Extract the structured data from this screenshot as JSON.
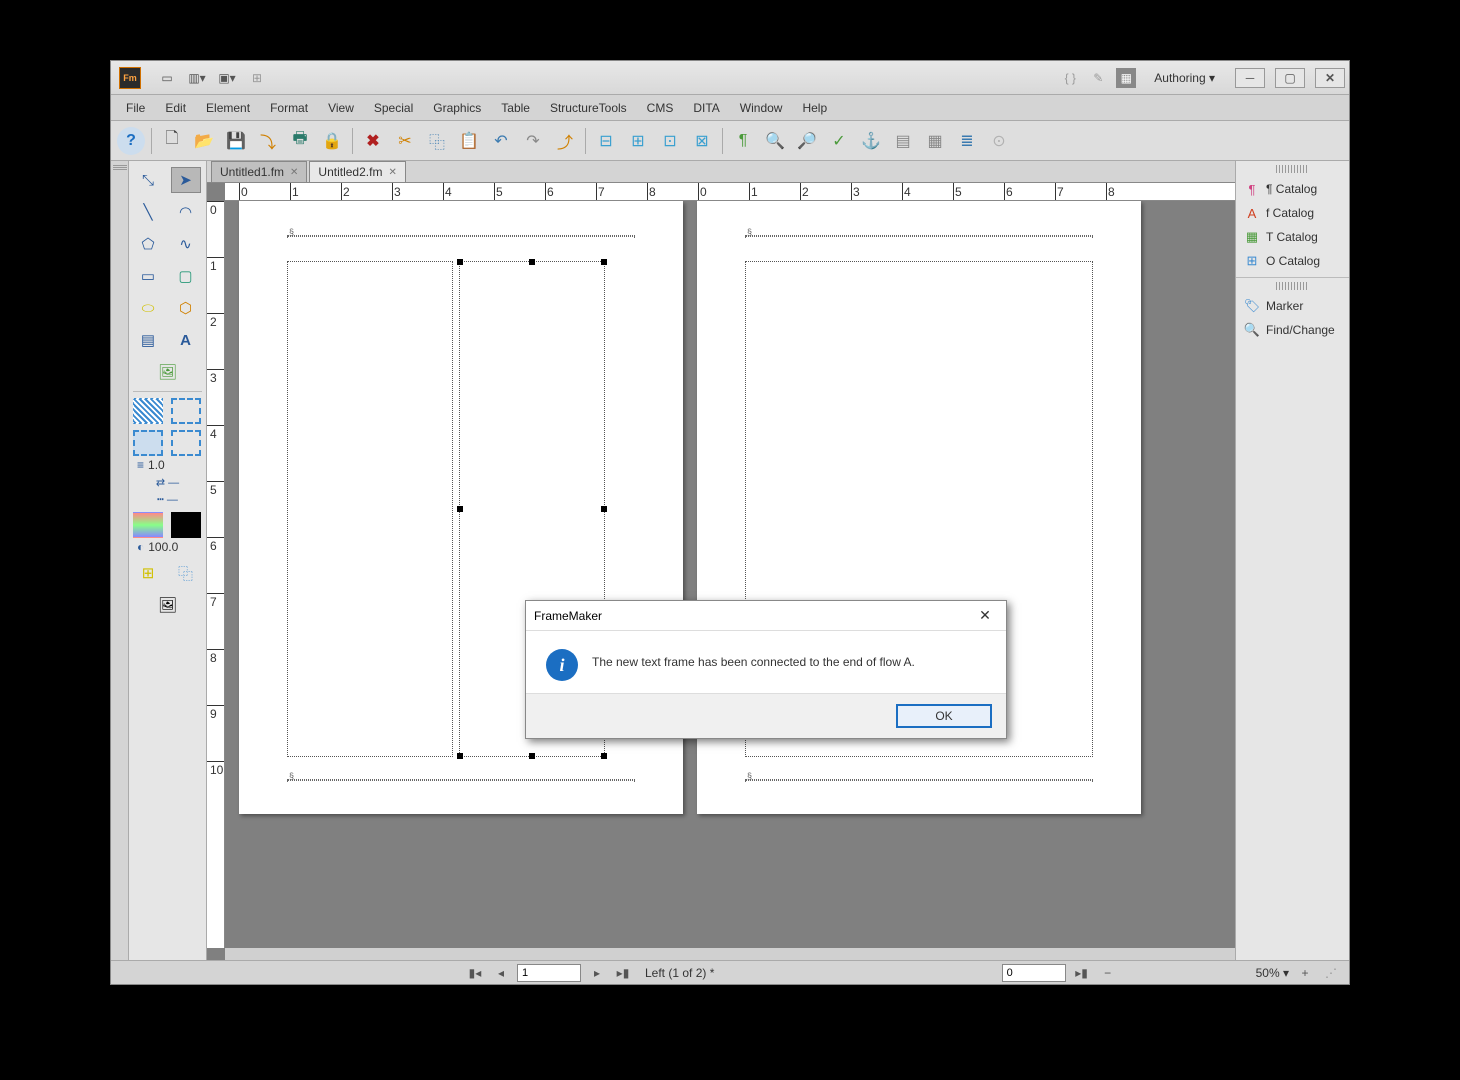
{
  "app": {
    "icon_text": "Fm",
    "mode_label": "Authoring"
  },
  "menu": [
    "File",
    "Edit",
    "Element",
    "Format",
    "View",
    "Special",
    "Graphics",
    "Table",
    "StructureTools",
    "CMS",
    "DITA",
    "Window",
    "Help"
  ],
  "tabs": [
    {
      "label": "Untitled1.fm",
      "active": false
    },
    {
      "label": "Untitled2.fm",
      "active": true
    }
  ],
  "ruler_h": [
    "0",
    "1",
    "2",
    "3",
    "4",
    "5",
    "6",
    "7",
    "8",
    "0",
    "1",
    "2",
    "3",
    "4",
    "5",
    "6",
    "7",
    "8"
  ],
  "ruler_v": [
    "0",
    "1",
    "2",
    "3",
    "4",
    "5",
    "6",
    "7",
    "8",
    "9",
    "10"
  ],
  "tool_palette": {
    "line_width": "1.0",
    "opacity": "100.0"
  },
  "right_panel": {
    "group1": [
      "¶ Catalog",
      "f Catalog",
      "T Catalog",
      "O Catalog"
    ],
    "group2": [
      "Marker",
      "Find/Change"
    ]
  },
  "dialog": {
    "title": "FrameMaker",
    "message": "The new text frame has been connected to the end of flow A.",
    "ok": "OK"
  },
  "status": {
    "page_value": "1",
    "page_label": "Left (1 of 2) *",
    "other_value": "0",
    "zoom": "50%"
  }
}
